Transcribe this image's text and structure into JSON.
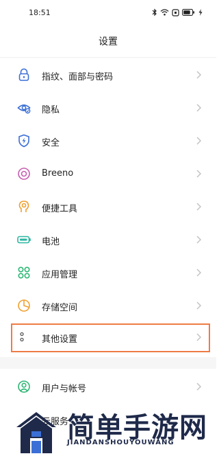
{
  "status_bar": {
    "time": "18:51"
  },
  "header": {
    "title": "设置"
  },
  "items": [
    {
      "label": "指纹、面部与密码",
      "icon": "lock-icon"
    },
    {
      "label": "隐私",
      "icon": "privacy-eye-icon"
    },
    {
      "label": "安全",
      "icon": "shield-icon"
    },
    {
      "label": "Breeno",
      "icon": "breeno-icon"
    },
    {
      "label": "便捷工具",
      "icon": "hand-tool-icon"
    },
    {
      "label": "电池",
      "icon": "battery-icon"
    },
    {
      "label": "应用管理",
      "icon": "apps-grid-icon"
    },
    {
      "label": "存储空间",
      "icon": "storage-pie-icon"
    },
    {
      "label": "其他设置",
      "icon": "more-dots-icon"
    },
    {
      "label": "用户与帐号",
      "icon": "user-icon"
    },
    {
      "label": "云服务",
      "icon": "cloud-icon"
    }
  ],
  "watermark": {
    "title": "简单手游网",
    "subtitle": "JIANDANSHOUYOUWANG"
  },
  "colors": {
    "highlight": "#ef7b45",
    "icon_blue": "#3b6fd6",
    "icon_green": "#2bb673",
    "icon_orange": "#f0a030",
    "icon_pink": "#c65fb0",
    "watermark": "#1f2a4a"
  }
}
